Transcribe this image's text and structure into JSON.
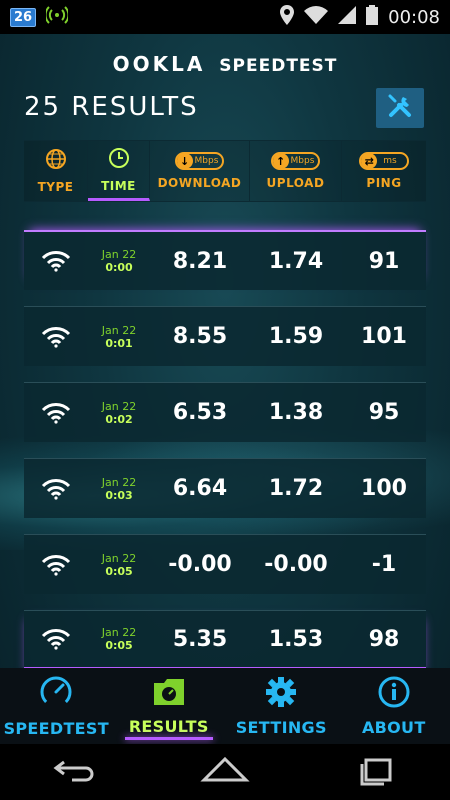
{
  "status_bar": {
    "notification_badge": "26",
    "time": "00:08",
    "icons": [
      "wifi-signal-icon",
      "location-icon",
      "wifi-icon",
      "cell-signal-icon",
      "battery-icon"
    ]
  },
  "header": {
    "brand_ookla": "OOKLA",
    "brand_speedtest": "SPEEDTEST",
    "results_count": "25 RESULTS",
    "tools_icon": "tools-icon"
  },
  "columns": {
    "type": "TYPE",
    "time": "TIME",
    "download": "DOWNLOAD",
    "download_unit": "Mbps",
    "upload": "UPLOAD",
    "upload_unit": "Mbps",
    "ping": "PING",
    "ping_unit": "ms",
    "sorted_by": "time"
  },
  "results": [
    {
      "date": "Jan 22",
      "time": "0:00",
      "download": "8.21",
      "upload": "1.74",
      "ping": "91"
    },
    {
      "date": "Jan 22",
      "time": "0:01",
      "download": "8.55",
      "upload": "1.59",
      "ping": "101"
    },
    {
      "date": "Jan 22",
      "time": "0:02",
      "download": "6.53",
      "upload": "1.38",
      "ping": "95"
    },
    {
      "date": "Jan 22",
      "time": "0:03",
      "download": "6.64",
      "upload": "1.72",
      "ping": "100"
    },
    {
      "date": "Jan 22",
      "time": "0:05",
      "download": "-0.00",
      "upload": "-0.00",
      "ping": "-1"
    },
    {
      "date": "Jan 22",
      "time": "0:05",
      "download": "5.35",
      "upload": "1.53",
      "ping": "98"
    }
  ],
  "bottom_nav": [
    {
      "label": "SPEEDTEST",
      "icon": "speedometer-icon",
      "active": false
    },
    {
      "label": "RESULTS",
      "icon": "folder-icon",
      "active": true
    },
    {
      "label": "SETTINGS",
      "icon": "gear-icon",
      "active": false
    },
    {
      "label": "ABOUT",
      "icon": "info-icon",
      "active": false
    }
  ],
  "colors": {
    "accent_orange": "#f5a623",
    "accent_green": "#c7ff5b",
    "accent_blue": "#27b7f2",
    "accent_purple": "#b65cff"
  }
}
